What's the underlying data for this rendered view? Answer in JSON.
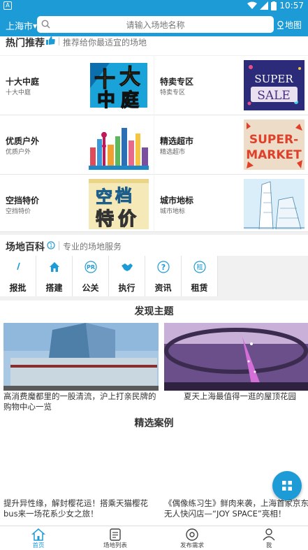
{
  "status_bar": {
    "time": "10:57"
  },
  "header": {
    "city": "上海市",
    "search_placeholder": "请输入场地名称",
    "map_label": "地图"
  },
  "hot": {
    "title": "热门推荐",
    "subtitle": "推荐给你最适宜的场地"
  },
  "categories": [
    {
      "title": "十大中庭",
      "subtitle": "十大中庭"
    },
    {
      "title": "特卖专区",
      "subtitle": "特卖专区",
      "art_line1": "SUPER",
      "art_line2": "SALE"
    },
    {
      "title": "优质户外",
      "subtitle": "优质户外"
    },
    {
      "title": "精选超市",
      "subtitle": "精选超市",
      "art_line1": "SUPER-",
      "art_line2": "MARKET"
    },
    {
      "title": "空挡特价",
      "subtitle": "空挡特价"
    },
    {
      "title": "城市地标",
      "subtitle": "城市地标"
    }
  ],
  "wiki": {
    "title": "场地百科",
    "subtitle": "专业的场地服务"
  },
  "tools": [
    {
      "label": "报批",
      "icon": "slash-icon"
    },
    {
      "label": "搭建",
      "icon": "home-icon"
    },
    {
      "label": "公关",
      "icon": "pr-icon",
      "glyph": "PR"
    },
    {
      "label": "执行",
      "icon": "handshake-icon"
    },
    {
      "label": "资讯",
      "icon": "question-icon",
      "glyph": "?"
    },
    {
      "label": "租赁",
      "icon": "rent-icon",
      "glyph": "租"
    }
  ],
  "discover": {
    "title": "发现主题",
    "items": [
      {
        "caption": "高消费魔都里的一股清流，沪上打亲民牌的购物中心一览"
      },
      {
        "caption": "夏天上海最值得一逛的屋顶花园"
      }
    ]
  },
  "cases": {
    "title": "精选案例",
    "items": [
      {
        "line1": "提升异性缘，解封樱花运！搭乘天猫樱花",
        "line2": "bus来一场花系少女之旅！"
      },
      {
        "line1": "《偶像练习生》鲜肉来袭，上海首家京东",
        "line2": "无人快闪店—“JOY SPACE”亮相！"
      }
    ]
  },
  "tabbar": [
    {
      "label": "首页",
      "icon": "home-icon",
      "active": true
    },
    {
      "label": "场地列表",
      "icon": "list-icon"
    },
    {
      "label": "发布需求",
      "icon": "publish-icon"
    },
    {
      "label": "我",
      "icon": "user-icon"
    }
  ],
  "colors": {
    "brand": "#1d9bd7",
    "background": "#f1f1f1"
  }
}
